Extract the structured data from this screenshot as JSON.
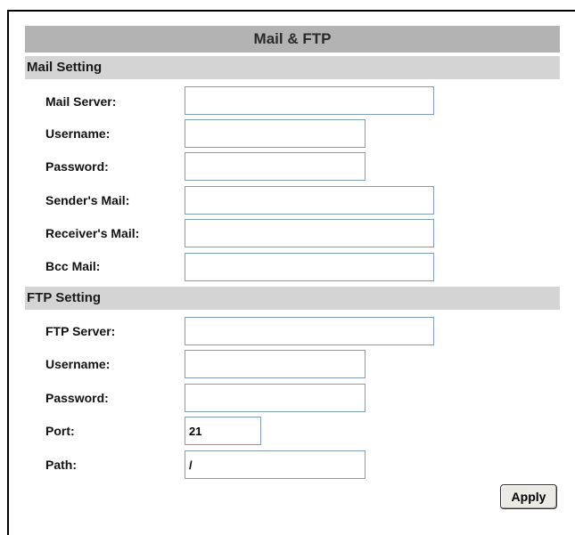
{
  "page_title": "Mail & FTP",
  "mail_section": {
    "title": "Mail Setting",
    "fields": [
      {
        "label": "Mail Server:",
        "value": ""
      },
      {
        "label": "Username:",
        "value": ""
      },
      {
        "label": "Password:",
        "value": ""
      },
      {
        "label": "Sender's Mail:",
        "value": ""
      },
      {
        "label": "Receiver's Mail:",
        "value": ""
      },
      {
        "label": "Bcc Mail:",
        "value": ""
      }
    ]
  },
  "ftp_section": {
    "title": "FTP Setting",
    "fields": [
      {
        "label": "FTP Server:",
        "value": ""
      },
      {
        "label": "Username:",
        "value": ""
      },
      {
        "label": "Password:",
        "value": ""
      },
      {
        "label": "Port:",
        "value": "21"
      },
      {
        "label": "Path:",
        "value": "/"
      }
    ]
  },
  "apply_label": "Apply"
}
